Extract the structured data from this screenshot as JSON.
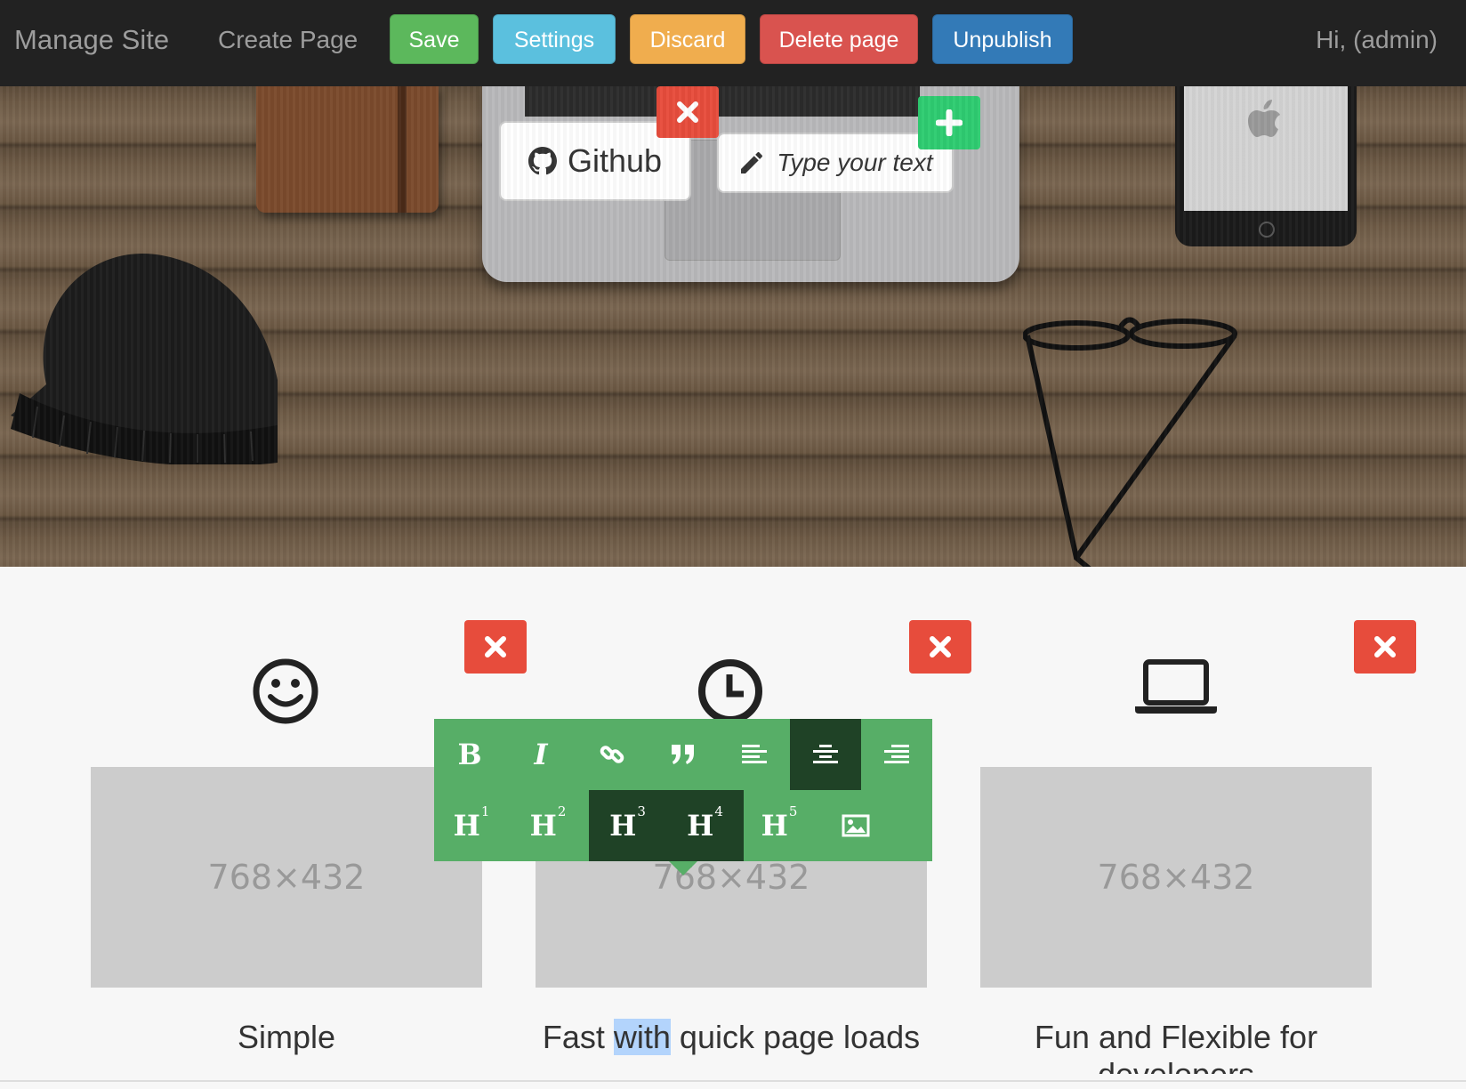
{
  "navbar": {
    "brand": "Manage Site",
    "create_page": "Create Page",
    "buttons": {
      "save": "Save",
      "settings": "Settings",
      "discard": "Discard",
      "delete_page": "Delete page",
      "unpublish": "Unpublish"
    },
    "user": "Hi, (admin)"
  },
  "hero": {
    "github_button": "Github",
    "add_button_placeholder": "Type your text"
  },
  "features": [
    {
      "image_label": "768×432",
      "text": "Simple",
      "icon": "smile-icon"
    },
    {
      "image_label": "768×432",
      "text_before": "Fast ",
      "text_selected": "with",
      "text_after": " quick page loads",
      "icon": "clock-icon"
    },
    {
      "image_label": "768×432",
      "text": "Fun and Flexible for developers",
      "icon": "laptop-icon"
    }
  ],
  "toolbar": {
    "row1": [
      "bold",
      "italic",
      "link",
      "quote",
      "align-left",
      "align-center",
      "align-right"
    ],
    "row2": [
      "H1",
      "H2",
      "H3",
      "H4",
      "H5",
      "image"
    ],
    "bold_label": "B",
    "italic_label": "I",
    "h_label": "H",
    "h_numbers": [
      "1",
      "2",
      "3",
      "4",
      "5"
    ],
    "active": [
      "align-center",
      "H3",
      "H4"
    ]
  },
  "colors": {
    "save": "#5cb85c",
    "settings": "#5bc0de",
    "discard": "#f0ad4e",
    "delete": "#d9534f",
    "unpublish": "#337ab7",
    "remove_button": "#e74c3c",
    "add_button": "#2ecc71",
    "toolbar": "#57ae67",
    "toolbar_active": "#1f4226"
  }
}
